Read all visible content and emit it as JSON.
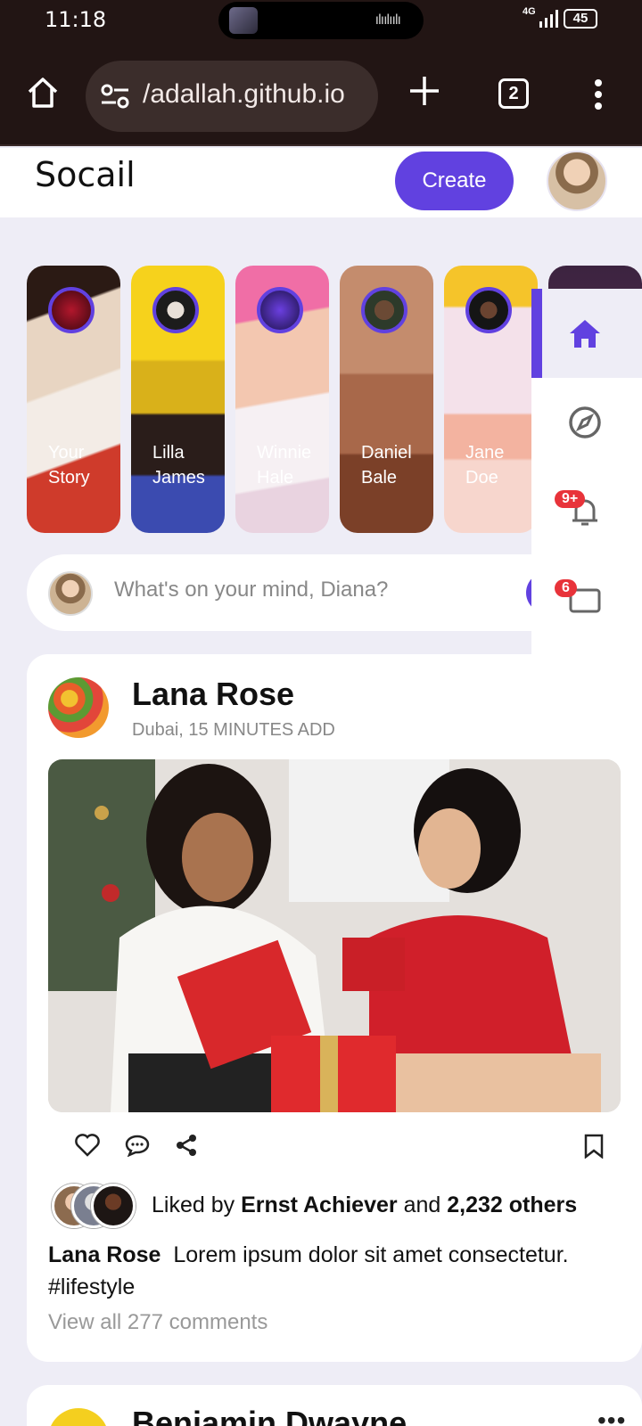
{
  "status": {
    "time": "11:18",
    "network": "4G",
    "battery": "45"
  },
  "browser": {
    "url": "/adallah.github.io",
    "tab_count": "2"
  },
  "app": {
    "logo": "Socail",
    "create_label": "Create"
  },
  "stories": [
    {
      "line1": "Your",
      "line2": "Story"
    },
    {
      "line1": "Lilla",
      "line2": "James"
    },
    {
      "line1": "Winnie",
      "line2": "Hale"
    },
    {
      "line1": "Daniel",
      "line2": "Bale"
    },
    {
      "line1": "Jane",
      "line2": "Doe"
    }
  ],
  "sidenav": {
    "items": [
      {
        "icon": "home-icon",
        "active": true
      },
      {
        "icon": "compass-icon"
      },
      {
        "icon": "bell-icon",
        "badge": "9+"
      },
      {
        "icon": "messages-icon",
        "badge": "6"
      },
      {
        "icon": "bookmark-icon"
      },
      {
        "icon": "analytics-icon"
      },
      {
        "icon": "palette-icon"
      },
      {
        "icon": "settings-icon"
      }
    ]
  },
  "composer": {
    "placeholder": "What's on your mind, Diana?"
  },
  "post": {
    "author": "Lana Rose",
    "meta": "Dubai, 15 MINUTES ADD",
    "liked_prefix": "Liked by",
    "liked_user": "Ernst Achiever",
    "liked_and": "and",
    "liked_others": "2,232 others",
    "caption_author": "Lana Rose",
    "caption_text": "Lorem ipsum dolor sit amet consectetur.",
    "hashtag": "#lifestyle",
    "view_comments": "View all 277 comments"
  },
  "next_post": {
    "author": "Benjamin Dwayne",
    "more": "•••"
  },
  "colors": {
    "accent": "#6141e0",
    "badge": "#e8333a",
    "browser_bg": "#221514"
  }
}
